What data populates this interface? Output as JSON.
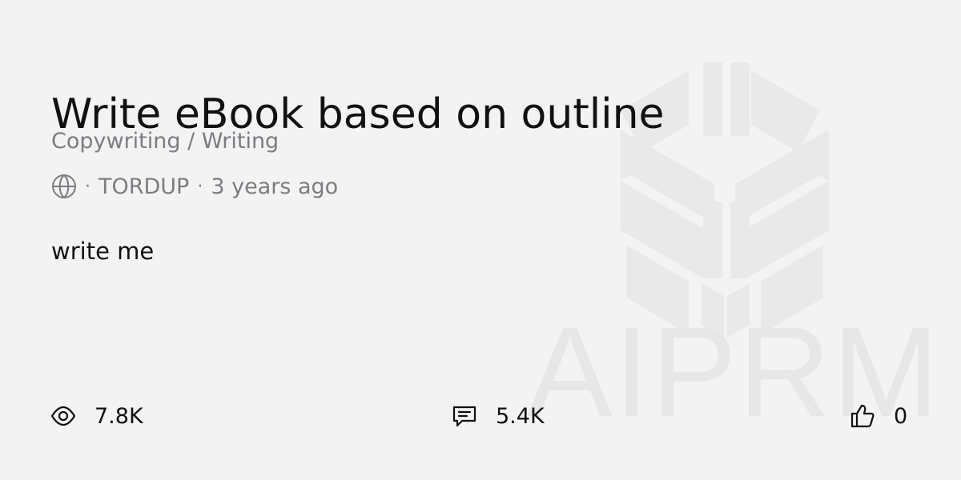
{
  "card": {
    "title": "Write eBook based on outline",
    "category": "Copywriting / Writing",
    "meta": {
      "separator": "·",
      "author": "TORDUP",
      "time_ago": "3 years ago",
      "visibility_icon": "globe-icon"
    },
    "description": "write me",
    "stats": {
      "views": {
        "icon": "eye-icon",
        "value": "7.8K"
      },
      "comments": {
        "icon": "comment-icon",
        "value": "5.4K"
      },
      "likes": {
        "icon": "thumbs-up-icon",
        "value": "0"
      }
    },
    "watermark": {
      "text": "AIPRM",
      "logo_icon": "aiprm-logo-icon"
    }
  },
  "colors": {
    "background": "#f3f3f3",
    "text": "#111111",
    "muted_text": "#7b7d82",
    "watermark": "#e8e8e8"
  }
}
